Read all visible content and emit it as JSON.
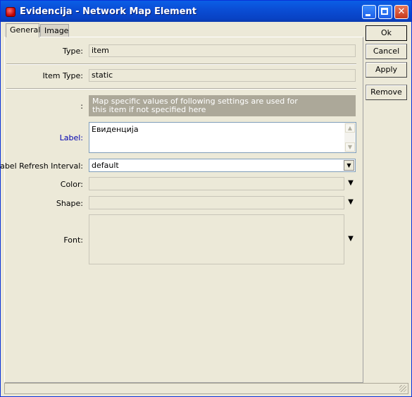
{
  "window": {
    "title": "Evidencija - Network Map Element",
    "controls": {
      "minimize": "minimize-icon",
      "maximize": "maximize-icon",
      "close": "close-icon"
    }
  },
  "tabs": [
    {
      "label": "General",
      "active": true
    },
    {
      "label": "Image",
      "active": false
    }
  ],
  "form": {
    "type": {
      "label": "Type:",
      "value": "item"
    },
    "item_type": {
      "label": "Item Type:",
      "value": "static"
    },
    "note": {
      "label": ":",
      "text_line1": "Map specific values of following settings are used for",
      "text_line2": "this item if not specified here"
    },
    "label_field": {
      "label": "Label:",
      "value": "Евиденција"
    },
    "label_refresh": {
      "label": "Label Refresh Interval:",
      "value": "default"
    },
    "color": {
      "label": "Color:",
      "value": ""
    },
    "shape": {
      "label": "Shape:",
      "value": ""
    },
    "font": {
      "label": "Font:",
      "value": ""
    }
  },
  "buttons": {
    "ok": "Ok",
    "cancel": "Cancel",
    "apply": "Apply",
    "remove": "Remove"
  },
  "colors": {
    "titlebar": "#0a4ed6",
    "dialog_bg": "#ece9d8",
    "note_bg": "#aca899",
    "label_blue": "#0000b0"
  }
}
